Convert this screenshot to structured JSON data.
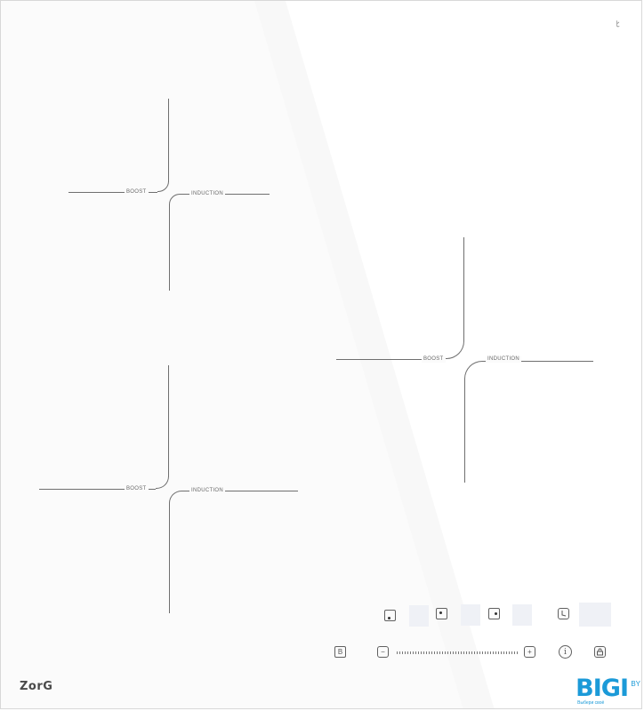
{
  "corner_symbol": "ﾋ",
  "zones": [
    {
      "boost_label": "BOOST",
      "induction_label": "INDUCTION"
    },
    {
      "boost_label": "BOOST",
      "induction_label": "INDUCTION"
    },
    {
      "boost_label": "BOOST",
      "induction_label": "INDUCTION"
    }
  ],
  "controls": {
    "boost_button": "B",
    "minus_symbol": "−",
    "plus_symbol": "+",
    "info_symbol": "i",
    "timer_icon": "clock-icon",
    "lock_icon": "lock-icon"
  },
  "brand": "ZorG",
  "watermark": {
    "logo": "BIGI",
    "domain": "BY",
    "tagline": "Выбери своё"
  }
}
